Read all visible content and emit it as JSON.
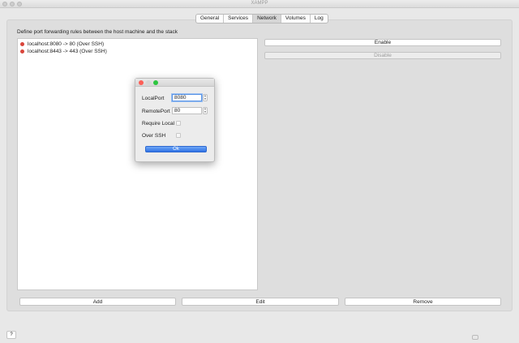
{
  "window": {
    "title": "XAMPP"
  },
  "tabs": [
    {
      "label": "General",
      "active": false
    },
    {
      "label": "Services",
      "active": false
    },
    {
      "label": "Network",
      "active": true
    },
    {
      "label": "Volumes",
      "active": false
    },
    {
      "label": "Log",
      "active": false
    }
  ],
  "network": {
    "description": "Define port forwarding rules between the host machine and the stack",
    "rules": [
      {
        "label": "localhost:8080 -> 80 (Over SSH)",
        "status_color": "#d9453b"
      },
      {
        "label": "localhost:8443 -> 443 (Over SSH)",
        "status_color": "#d9453b"
      }
    ],
    "enable_label": "Enable",
    "disable_label": "Disable",
    "add_label": "Add",
    "edit_label": "Edit",
    "remove_label": "Remove"
  },
  "help_label": "?",
  "dialog": {
    "local_port_label": "LocalPort",
    "local_port_value": "8080",
    "remote_port_label": "RemotePort",
    "remote_port_value": "80",
    "require_local_label": "Require Local",
    "over_ssh_label": "Over SSH",
    "ok_label": "Ok"
  },
  "colors": {
    "accent": "#3a7ee8",
    "status_stopped": "#d9453b"
  }
}
